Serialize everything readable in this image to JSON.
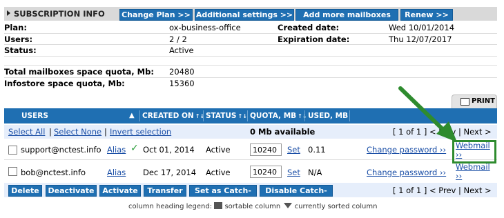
{
  "header": {
    "title": "SUBSCRIPTION INFO",
    "buttons": [
      "Change Plan >>",
      "Additional settings >>",
      "Add more mailboxes >>",
      "Renew >>"
    ]
  },
  "info": {
    "plan_label": "Plan:",
    "plan_value": "ox-business-office",
    "users_label": "Users:",
    "users_value": "2 / 2",
    "status_label": "Status:",
    "status_value": "Active",
    "created_label": "Created date:",
    "created_value": "Wed 10/01/2014",
    "expiration_label": "Expiration date:",
    "expiration_value": "Thu 12/07/2017",
    "mailbox_quota_label": "Total mailboxes space quota, Mb:",
    "mailbox_quota_value": "20480",
    "infostore_quota_label": "Infostore space quota, Mb:",
    "infostore_quota_value": "15360"
  },
  "print_tab": "PRINT",
  "table": {
    "columns": [
      "USERS",
      "CREATED ON",
      "STATUS",
      "QUOTA, MB",
      "USED, MB"
    ],
    "select_all": "Select All",
    "select_none": "Select None",
    "invert_selection": "Invert selection",
    "available": "0 Mb available",
    "pager_top": "[ 1 of 1 ] < Prev | Next >",
    "pager_bottom": "[ 1 of 1 ] < Prev | Next >",
    "rows": [
      {
        "user": "support@nctest.info",
        "alias": "Alias",
        "verified": true,
        "created": "Oct 01, 2014",
        "status": "Active",
        "quota": "10240",
        "set": "Set",
        "used": "0.11",
        "change_password": "Change password ››",
        "webmail": "Webmail ››"
      },
      {
        "user": "bob@nctest.info",
        "alias": "Alias",
        "verified": false,
        "created": "Dec 17, 2014",
        "status": "Active",
        "quota": "10240",
        "set": "Set",
        "used": "N/A",
        "change_password": "Change password ››",
        "webmail": "Webmail ››"
      }
    ]
  },
  "actions": [
    "Delete",
    "Deactivate",
    "Activate",
    "Transfer",
    "Set as Catch-all",
    "Disable Catch-all"
  ],
  "legend": {
    "prefix": "column heading legend:",
    "sortable": "sortable column",
    "sorted": "currently sorted column"
  },
  "colors": {
    "accent_blue": "#1f6fb2",
    "annotation_green": "#2e8b2e",
    "check_green": "#2a9d3a"
  }
}
